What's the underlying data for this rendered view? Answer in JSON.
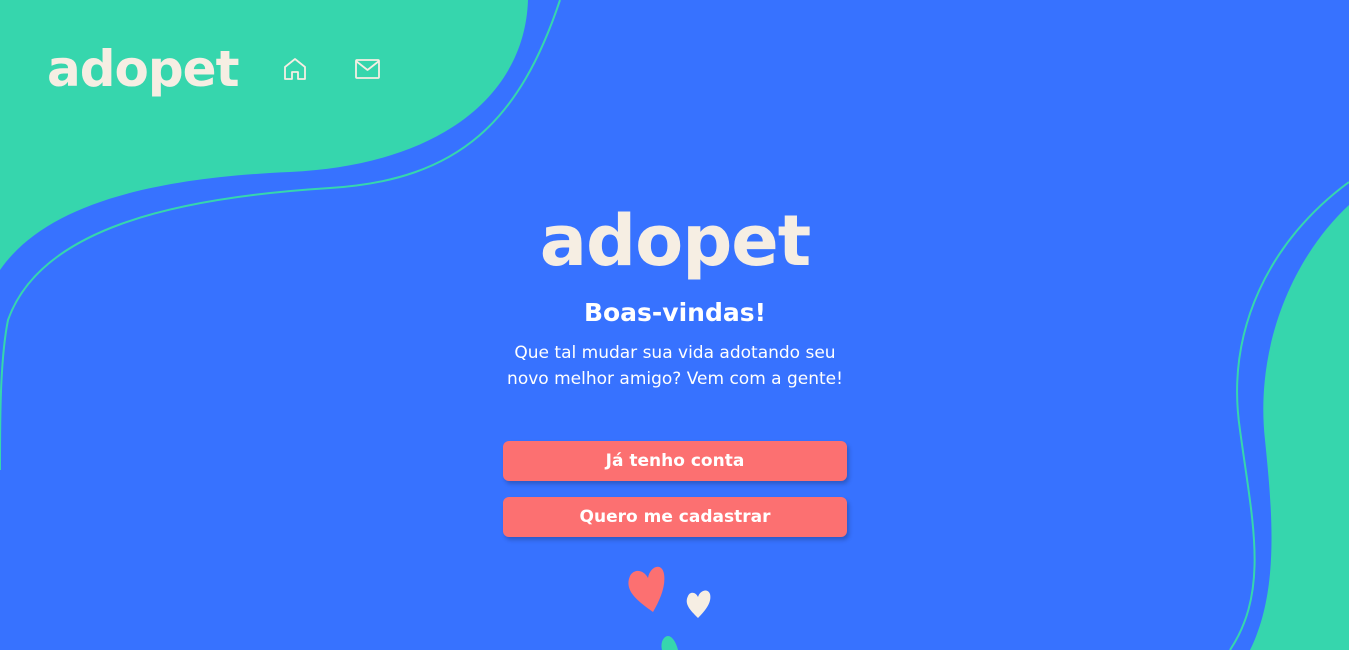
{
  "header": {
    "logo_text": "adopet",
    "nav": [
      {
        "name": "home-icon"
      },
      {
        "name": "mail-icon"
      }
    ]
  },
  "hero": {
    "logo_text": "adopet",
    "title": "Boas-vindas!",
    "subtitle": "Que tal mudar sua vida adotando seu novo melhor amigo? Vem com a gente!",
    "login_button": "Já tenho conta",
    "signup_button": "Quero me cadastrar"
  },
  "colors": {
    "background": "#3772FF",
    "accent_green": "#36D6AD",
    "button": "#FC7071",
    "logo": "#F6EEE3"
  }
}
